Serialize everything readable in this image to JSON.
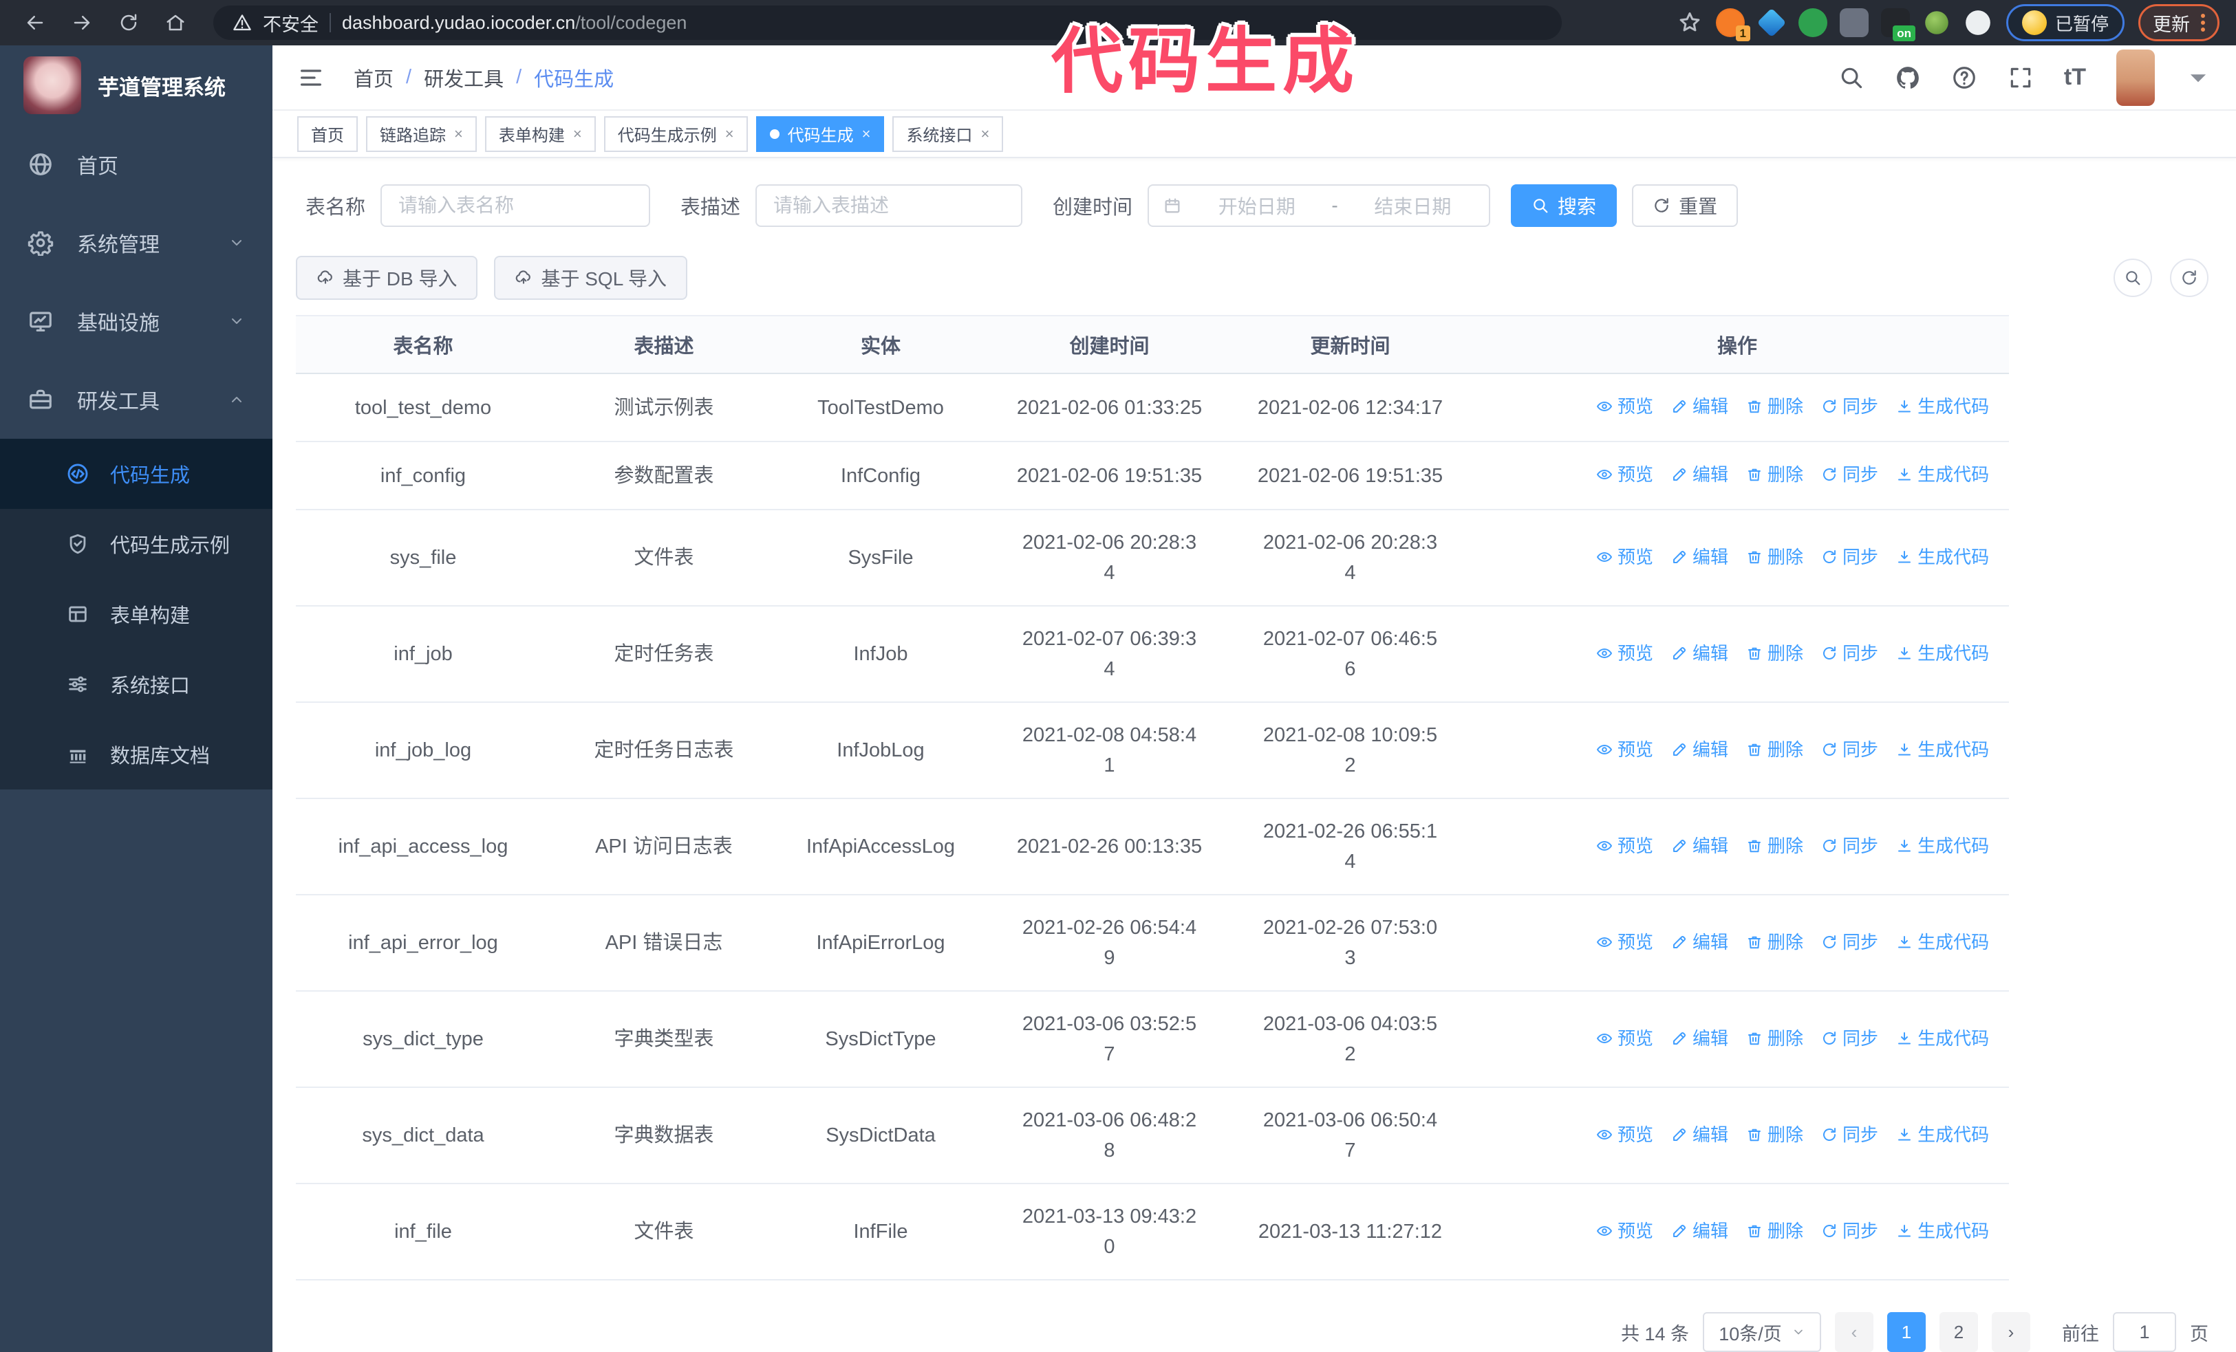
{
  "browser": {
    "security_label": "不安全",
    "url_host": "dashboard.yudao.iocoder.cn",
    "url_path": "/tool/codegen",
    "nav_icons": [
      "back-icon",
      "forward-icon",
      "reload-icon",
      "home-icon"
    ],
    "bookmark_icon": "star-icon",
    "extensions": [
      {
        "name": "orange-circle-extension",
        "badge": "1"
      },
      {
        "name": "blue-diamond-extension"
      },
      {
        "name": "green-check-extension"
      },
      {
        "name": "grid-extension"
      },
      {
        "name": "dark-on-extension",
        "badge": "on"
      },
      {
        "name": "green-bot-extension"
      },
      {
        "name": "puzzle-extension"
      }
    ],
    "profile_badge": "已暂停",
    "update_button": "更新"
  },
  "annotation": {
    "text": "代码生成",
    "color": "#fb4a68"
  },
  "sidebar": {
    "logo_title": "芋道管理系统",
    "items": [
      {
        "label": "首页",
        "icon": "dashboard-icon"
      },
      {
        "label": "系统管理",
        "icon": "gear-icon",
        "arrow": "chevron-down-icon"
      },
      {
        "label": "基础设施",
        "icon": "monitor-icon",
        "arrow": "chevron-down-icon"
      },
      {
        "label": "研发工具",
        "icon": "toolbox-icon",
        "arrow": "chevron-up-icon"
      }
    ],
    "sub_items": [
      {
        "label": "代码生成",
        "icon": "code-icon",
        "active": true
      },
      {
        "label": "代码生成示例",
        "icon": "shield-check-icon"
      },
      {
        "label": "表单构建",
        "icon": "form-icon"
      },
      {
        "label": "系统接口",
        "icon": "sliders-icon"
      },
      {
        "label": "数据库文档",
        "icon": "database-icon"
      }
    ]
  },
  "breadcrumb": [
    "首页",
    "研发工具",
    "代码生成"
  ],
  "tabs": [
    {
      "label": "首页",
      "closable": false,
      "active": false
    },
    {
      "label": "链路追踪",
      "closable": true,
      "active": false
    },
    {
      "label": "表单构建",
      "closable": true,
      "active": false
    },
    {
      "label": "代码生成示例",
      "closable": true,
      "active": false
    },
    {
      "label": "代码生成",
      "closable": true,
      "active": true
    },
    {
      "label": "系统接口",
      "closable": true,
      "active": false
    }
  ],
  "filter": {
    "name_label": "表名称",
    "name_placeholder": "请输入表名称",
    "desc_label": "表描述",
    "desc_placeholder": "请输入表描述",
    "time_label": "创建时间",
    "start_placeholder": "开始日期",
    "range_separator": "-",
    "end_placeholder": "结束日期",
    "search_label": "搜索",
    "reset_label": "重置"
  },
  "toolbar": {
    "import_db_label": "基于 DB 导入",
    "import_sql_label": "基于 SQL 导入"
  },
  "table": {
    "columns": [
      "表名称",
      "表描述",
      "实体",
      "创建时间",
      "更新时间",
      "操作"
    ],
    "ops": [
      "预览",
      "编辑",
      "删除",
      "同步",
      "生成代码"
    ],
    "ops_icons": [
      "eye-icon",
      "edit-icon",
      "delete-icon",
      "sync-icon",
      "download-icon"
    ],
    "rows": [
      {
        "name": "tool_test_demo",
        "desc": "测试示例表",
        "entity": "ToolTestDemo",
        "created": "2021-02-06 01:33:25",
        "updated": "2021-02-06 12:34:17"
      },
      {
        "name": "inf_config",
        "desc": "参数配置表",
        "entity": "InfConfig",
        "created": "2021-02-06 19:51:35",
        "updated": "2021-02-06 19:51:35"
      },
      {
        "name": "sys_file",
        "desc": "文件表",
        "entity": "SysFile",
        "created": "2021-02-06 20:28:3\n4",
        "updated": "2021-02-06 20:28:3\n4"
      },
      {
        "name": "inf_job",
        "desc": "定时任务表",
        "entity": "InfJob",
        "created": "2021-02-07 06:39:3\n4",
        "updated": "2021-02-07 06:46:5\n6"
      },
      {
        "name": "inf_job_log",
        "desc": "定时任务日志表",
        "entity": "InfJobLog",
        "created": "2021-02-08 04:58:4\n1",
        "updated": "2021-02-08 10:09:5\n2"
      },
      {
        "name": "inf_api_access_log",
        "desc": "API 访问日志表",
        "entity": "InfApiAccessLog",
        "created": "2021-02-26 00:13:35",
        "updated": "2021-02-26 06:55:1\n4"
      },
      {
        "name": "inf_api_error_log",
        "desc": "API 错误日志",
        "entity": "InfApiErrorLog",
        "created": "2021-02-26 06:54:4\n9",
        "updated": "2021-02-26 07:53:0\n3"
      },
      {
        "name": "sys_dict_type",
        "desc": "字典类型表",
        "entity": "SysDictType",
        "created": "2021-03-06 03:52:5\n7",
        "updated": "2021-03-06 04:03:5\n2"
      },
      {
        "name": "sys_dict_data",
        "desc": "字典数据表",
        "entity": "SysDictData",
        "created": "2021-03-06 06:48:2\n8",
        "updated": "2021-03-06 06:50:4\n7"
      },
      {
        "name": "inf_file",
        "desc": "文件表",
        "entity": "InfFile",
        "created": "2021-03-13 09:43:2\n0",
        "updated": "2021-03-13 11:27:12"
      }
    ]
  },
  "pagination": {
    "total_label": "共 14 条",
    "page_size": "10条/页",
    "pages": [
      "1",
      "2"
    ],
    "active_page": "1",
    "goto_label": "前往",
    "goto_value": "1",
    "goto_suffix": "页"
  }
}
